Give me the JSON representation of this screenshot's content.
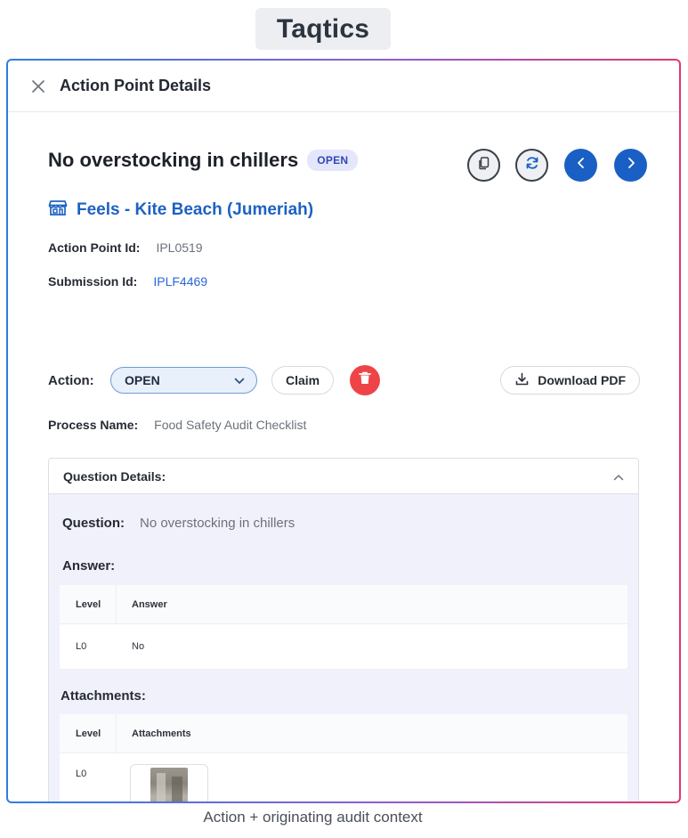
{
  "brand": {
    "name": "Taqtics"
  },
  "panel": {
    "title": "Action Point Details"
  },
  "action_point": {
    "title": "No overstocking in chillers",
    "status": "OPEN",
    "location": "Feels - Kite Beach (Jumeriah)",
    "fields": {
      "id_label": "Action Point Id:",
      "id_value": "IPL0519",
      "submission_label": "Submission Id:",
      "submission_value": "IPLF4469"
    },
    "action": {
      "label": "Action:",
      "selected": "OPEN",
      "claim_label": "Claim",
      "download_label": "Download PDF"
    },
    "process": {
      "label": "Process Name:",
      "value": "Food Safety Audit Checklist"
    }
  },
  "question_details": {
    "header": "Question Details:",
    "question_label": "Question:",
    "question_value": "No overstocking in chillers",
    "answer_title": "Answer:",
    "answer_table": {
      "columns": [
        "Level",
        "Answer"
      ],
      "rows": [
        [
          "L0",
          "No"
        ]
      ]
    },
    "attachments_title": "Attachments:",
    "attachments_table": {
      "columns": [
        "Level",
        "Attachments"
      ],
      "rows": [
        [
          "L0"
        ]
      ]
    }
  },
  "caption": "Action + originating audit context",
  "colors": {
    "accent": "#1a5fc4",
    "link": "#2a66d8",
    "danger": "#ee4448",
    "badge_bg": "#e4e7fa",
    "card_bg": "#f1f1fc"
  },
  "icons": [
    "close-icon",
    "copy-icon",
    "refresh-icon",
    "chevron-left-icon",
    "chevron-right-icon",
    "store-icon",
    "chevron-down-icon",
    "trash-icon",
    "download-icon",
    "chevron-up-icon"
  ]
}
